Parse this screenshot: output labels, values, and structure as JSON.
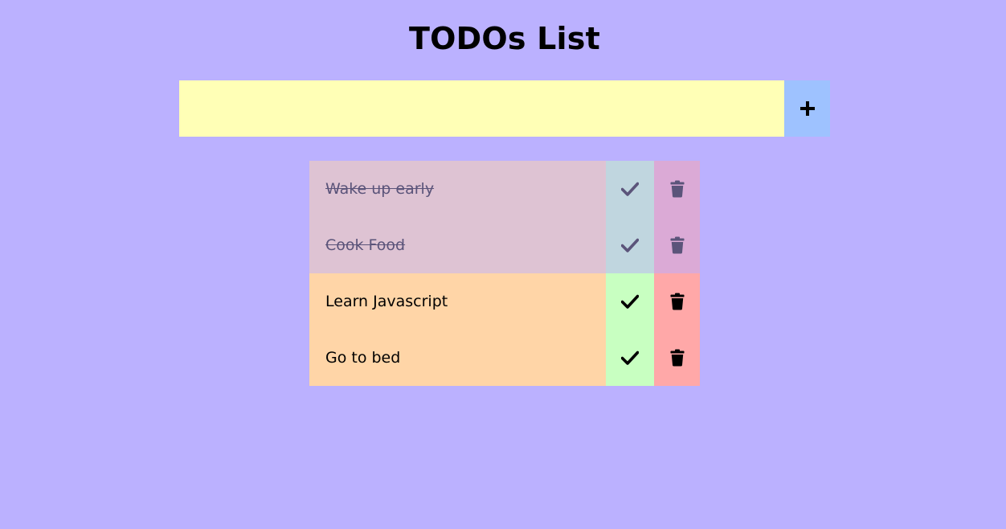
{
  "header": {
    "title": "TODOs List"
  },
  "form": {
    "input_value": "",
    "add_icon": "plus-icon"
  },
  "todos": [
    {
      "text": "Wake up early",
      "completed": true
    },
    {
      "text": "Cook Food",
      "completed": true
    },
    {
      "text": "Learn Javascript",
      "completed": false
    },
    {
      "text": "Go to bed",
      "completed": false
    }
  ],
  "icons": {
    "complete": "check-icon",
    "delete": "trash-icon"
  },
  "colors": {
    "background": "#bbb1ff",
    "input": "#ffffb6",
    "add_button": "#9ec2ff",
    "item": "#ffd5a7",
    "check_button": "#c8ffc1",
    "trash_button": "#ffa8a8",
    "completed_item": "#dec3d3",
    "completed_check": "#c0d6df",
    "completed_trash": "#dbaad6",
    "completed_text": "#5b547a"
  }
}
